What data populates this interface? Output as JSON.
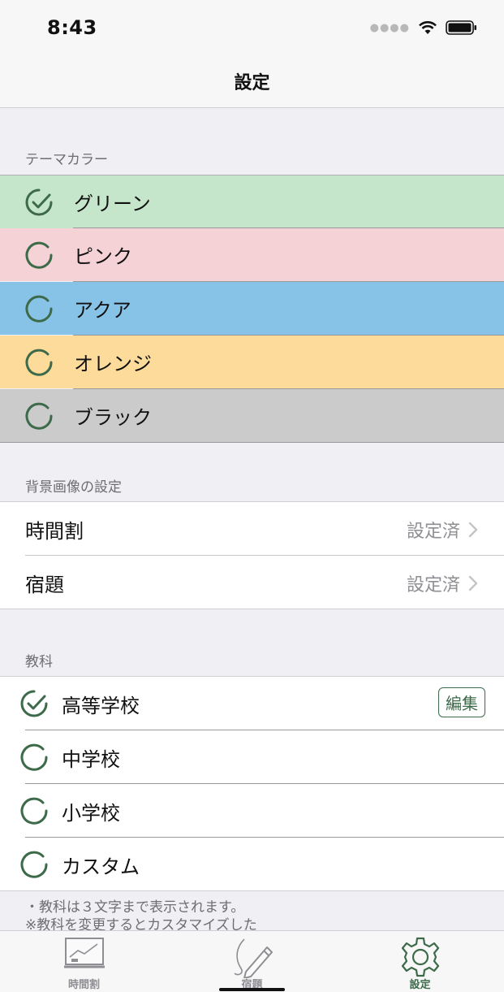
{
  "status": {
    "time": "8:43"
  },
  "nav": {
    "title": "設定"
  },
  "theme_section": {
    "header": "テーマカラー",
    "items": [
      {
        "label": "グリーン",
        "color": "#c6e6cc",
        "selected": true
      },
      {
        "label": "ピンク",
        "color": "#f5d2d6",
        "selected": false
      },
      {
        "label": "アクア",
        "color": "#87c3e6",
        "selected": false
      },
      {
        "label": "オレンジ",
        "color": "#fcdb9b",
        "selected": false
      },
      {
        "label": "ブラック",
        "color": "#cbcbcb",
        "selected": false
      }
    ]
  },
  "background_section": {
    "header": "背景画像の設定",
    "items": [
      {
        "label": "時間割",
        "value": "設定済"
      },
      {
        "label": "宿題",
        "value": "設定済"
      }
    ]
  },
  "subject_section": {
    "header": "教科",
    "edit_label": "編集",
    "items": [
      {
        "label": "高等学校",
        "selected": true
      },
      {
        "label": "中学校",
        "selected": false
      },
      {
        "label": "小学校",
        "selected": false
      },
      {
        "label": "カスタム",
        "selected": false
      }
    ],
    "note_lines": [
      "・教科は３文字まで表示されます。",
      "※教科を変更するとカスタマイズした"
    ]
  },
  "tabs": [
    {
      "label": "時間割",
      "icon": "timetable-icon",
      "active": false
    },
    {
      "label": "宿題",
      "icon": "pencil-icon",
      "active": false
    },
    {
      "label": "設定",
      "icon": "gear-icon",
      "active": true
    }
  ],
  "colors": {
    "accent": "#3d6b4a"
  }
}
